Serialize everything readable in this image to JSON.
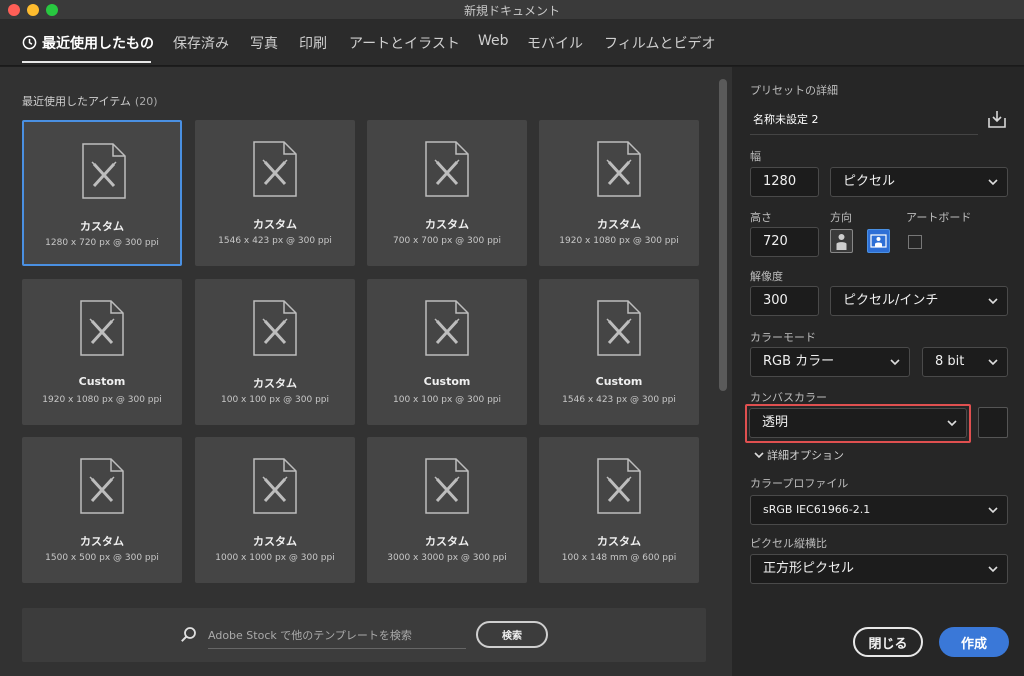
{
  "window": {
    "title": "新規ドキュメント"
  },
  "tabs": [
    {
      "label": "最近使用したもの"
    },
    {
      "label": "保存済み"
    },
    {
      "label": "写真"
    },
    {
      "label": "印刷"
    },
    {
      "label": "アートとイラスト"
    },
    {
      "label": "Web"
    },
    {
      "label": "モバイル"
    },
    {
      "label": "フィルムとビデオ"
    }
  ],
  "recent": {
    "title": "最近使用したアイテム",
    "count": "(20)",
    "items": [
      {
        "name": "カスタム",
        "size": "1280 x 720 px @ 300 ppi"
      },
      {
        "name": "カスタム",
        "size": "1546 x 423 px @ 300 ppi"
      },
      {
        "name": "カスタム",
        "size": "700 x 700 px @ 300 ppi"
      },
      {
        "name": "カスタム",
        "size": "1920 x 1080 px @ 300 ppi"
      },
      {
        "name": "Custom",
        "size": "1920 x 1080 px @ 300 ppi"
      },
      {
        "name": "カスタム",
        "size": "100 x 100 px @ 300 ppi"
      },
      {
        "name": "Custom",
        "size": "100 x 100 px @ 300 ppi"
      },
      {
        "name": "Custom",
        "size": "1546 x 423 px @ 300 ppi"
      },
      {
        "name": "カスタム",
        "size": "1500 x 500 px @ 300 ppi"
      },
      {
        "name": "カスタム",
        "size": "1000 x 1000 px @ 300 ppi"
      },
      {
        "name": "カスタム",
        "size": "3000 x 3000 px @ 300 ppi"
      },
      {
        "name": "カスタム",
        "size": "100 x 148 mm @ 600 ppi"
      }
    ]
  },
  "search": {
    "placeholder": "Adobe Stock で他のテンプレートを検索",
    "button": "検索"
  },
  "preset": {
    "title": "プリセットの詳細",
    "name": "名称未設定 2",
    "width_label": "幅",
    "width_value": "1280",
    "width_unit": "ピクセル",
    "height_label": "高さ",
    "height_value": "720",
    "orientation_label": "方向",
    "artboard_label": "アートボード",
    "resolution_label": "解像度",
    "resolution_value": "300",
    "resolution_unit": "ピクセル/インチ",
    "color_mode_label": "カラーモード",
    "color_mode_value": "RGB カラー",
    "bit_depth": "8 bit",
    "canvas_color_label": "カンバスカラー",
    "canvas_color_value": "透明",
    "advanced_label": "詳細オプション",
    "color_profile_label": "カラープロファイル",
    "color_profile_value": "sRGB IEC61966-2.1",
    "pixel_aspect_label": "ピクセル縦横比",
    "pixel_aspect_value": "正方形ピクセル"
  },
  "buttons": {
    "close": "閉じる",
    "create": "作成"
  },
  "colors": {
    "accent": "#3a78d8",
    "selection": "#4a90e2",
    "highlight": "#e05050"
  },
  "icons": [
    "clock-icon",
    "document-icon",
    "search-icon",
    "save-preset-icon",
    "chevron-down-icon",
    "portrait-icon",
    "landscape-icon"
  ]
}
